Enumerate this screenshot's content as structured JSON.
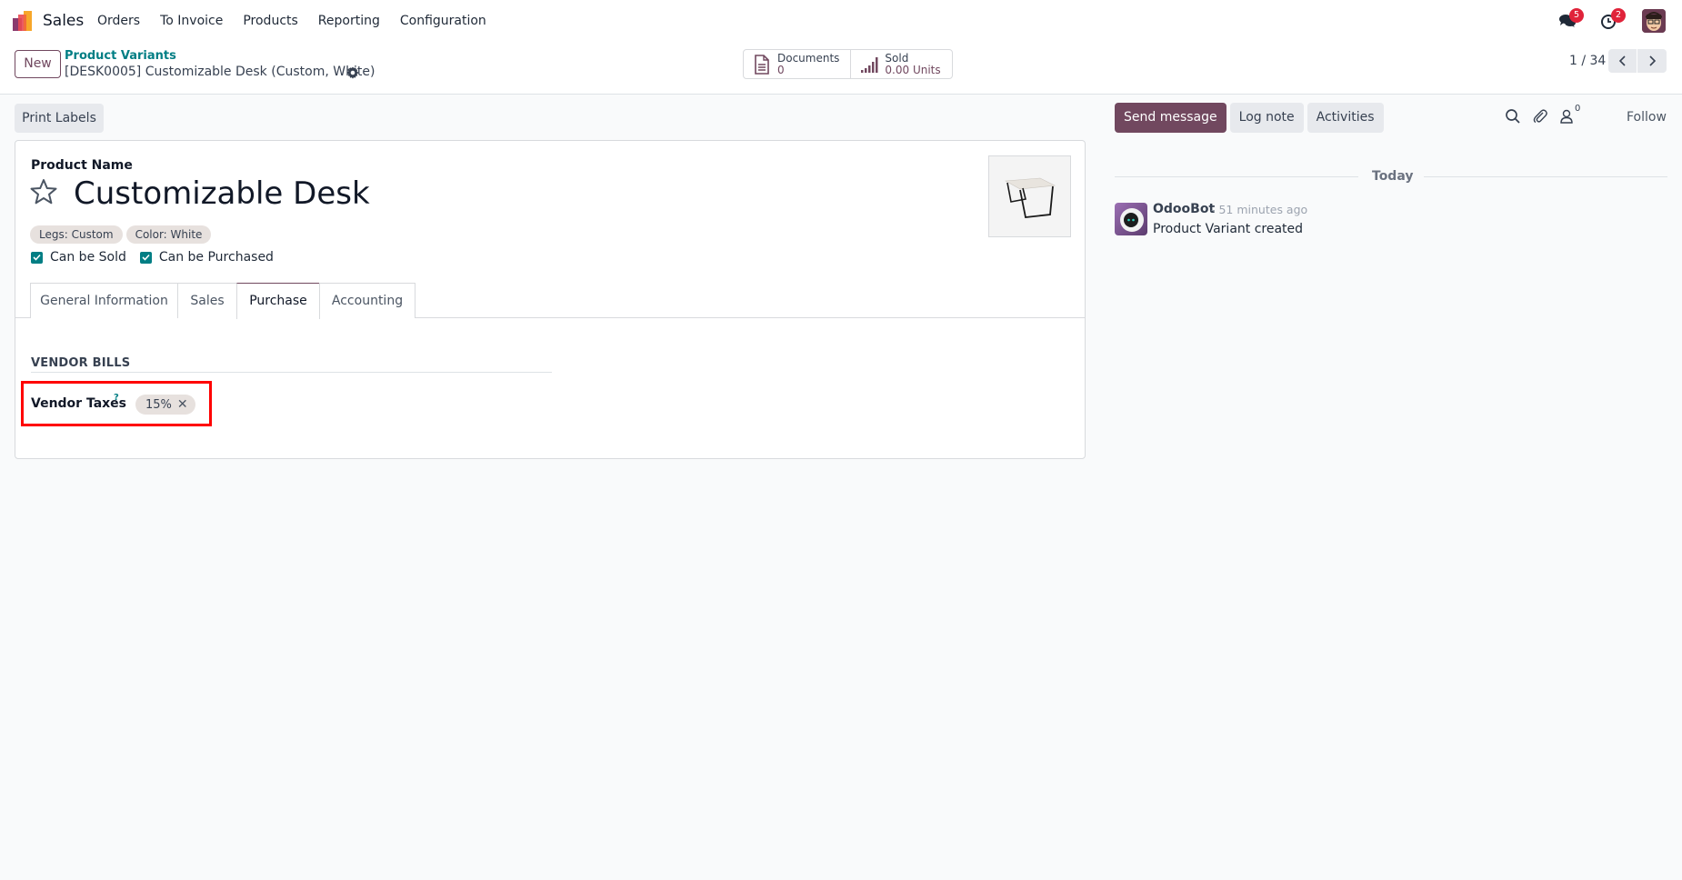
{
  "navbar": {
    "app_name": "Sales",
    "menu": [
      "Orders",
      "To Invoice",
      "Products",
      "Reporting",
      "Configuration"
    ],
    "messages_badge": "5",
    "activities_badge": "2",
    "brand_color": "#71485f",
    "badge_color": "#e0233a"
  },
  "control_panel": {
    "new_label": "New",
    "breadcrumb_parent": "Product Variants",
    "breadcrumb_current": "[DESK0005] Customizable Desk (Custom, White)",
    "smart_buttons": [
      {
        "icon": "document-icon",
        "label": "Documents",
        "value": "0"
      },
      {
        "icon": "bar-chart-icon",
        "label": "Sold",
        "value": "0.00 Units"
      }
    ],
    "pager": "1 / 34"
  },
  "form": {
    "print_labels": "Print Labels",
    "product_name_label": "Product Name",
    "product_name": "Customizable Desk",
    "attribute_tags": [
      "Legs: Custom",
      "Color: White"
    ],
    "checkboxes": [
      {
        "label": "Can be Sold",
        "checked": true
      },
      {
        "label": "Can be Purchased",
        "checked": true
      }
    ],
    "tabs": [
      {
        "label": "General Information",
        "active": false
      },
      {
        "label": "Sales",
        "active": false
      },
      {
        "label": "Purchase",
        "active": true
      },
      {
        "label": "Accounting",
        "active": false
      }
    ],
    "section_title": "VENDOR BILLS",
    "vendor_taxes_label": "Vendor Taxes",
    "help_mark": "?",
    "vendor_taxes": [
      "15%"
    ],
    "remove_glyph": "✕",
    "accent_color": "#017e84"
  },
  "chatter": {
    "send_message": "Send message",
    "log_note": "Log note",
    "activities": "Activities",
    "followers_count": "0",
    "follow": "Follow",
    "date_separator": "Today",
    "messages": [
      {
        "author": "OdooBot",
        "date": "- 51 minutes ago",
        "body": "Product Variant created"
      }
    ]
  }
}
